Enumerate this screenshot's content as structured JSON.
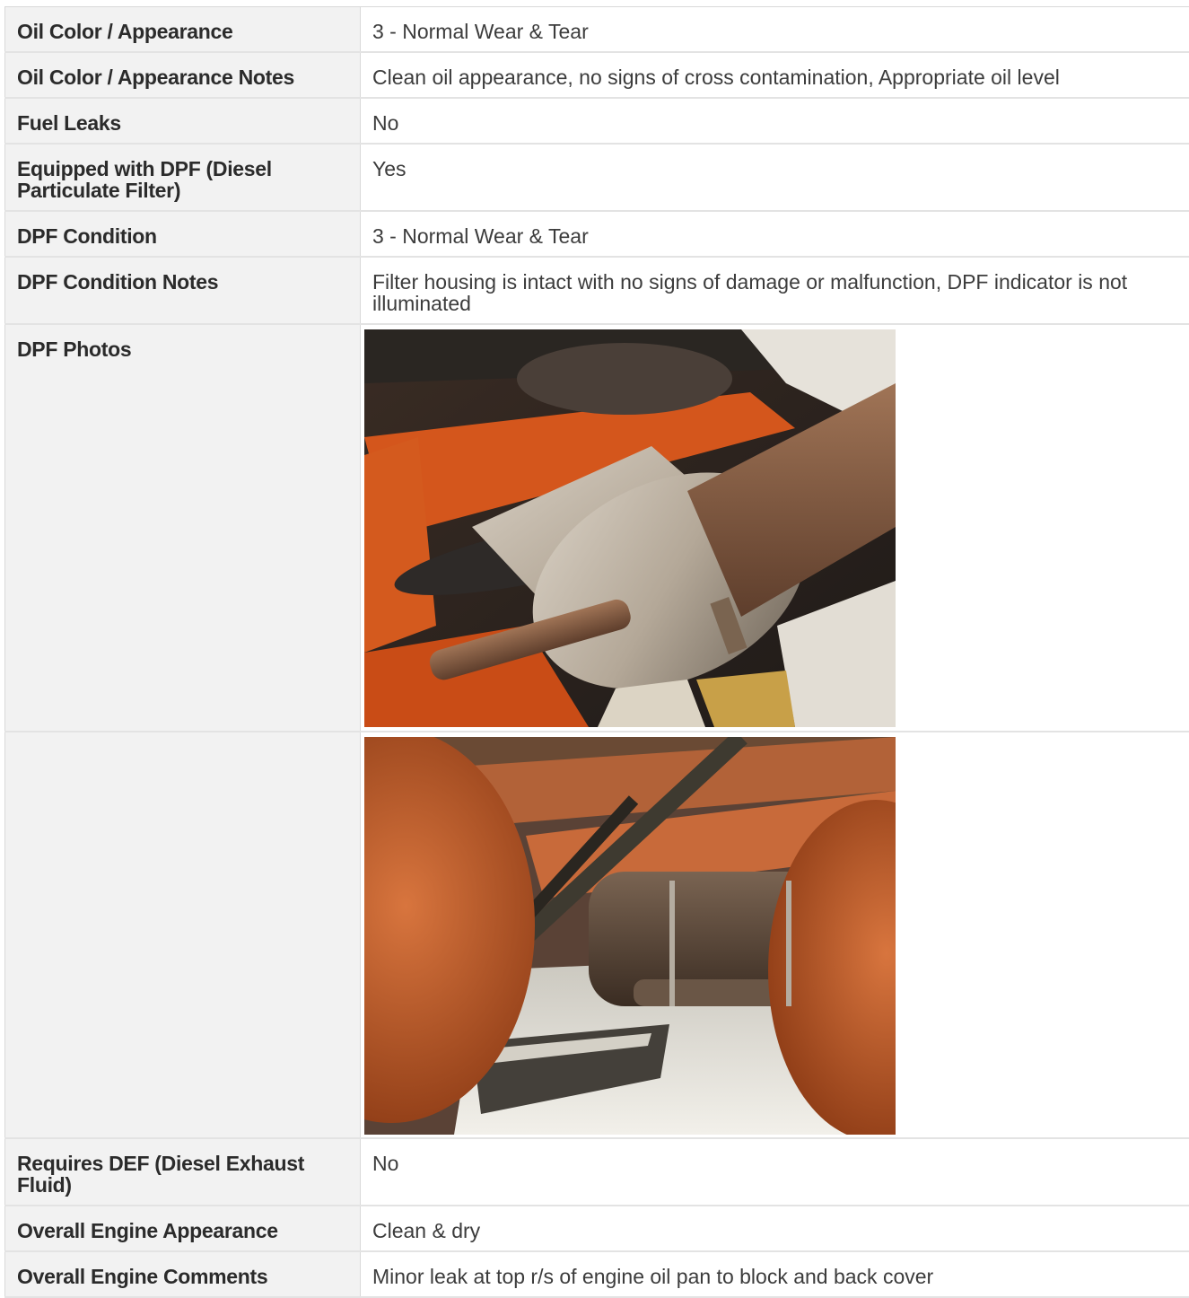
{
  "rows": [
    {
      "label": "Oil Color / Appearance",
      "value": "3 - Normal Wear & Tear"
    },
    {
      "label": "Oil Color / Appearance Notes",
      "value": "Clean oil appearance, no signs of cross contamination, Appropriate oil level"
    },
    {
      "label": "Fuel Leaks",
      "value": "No"
    },
    {
      "label": "Equipped with DPF (Diesel Particulate Filter)",
      "value": "Yes"
    },
    {
      "label": "DPF Condition",
      "value": "3 - Normal Wear & Tear"
    },
    {
      "label": "DPF Condition Notes",
      "value": "Filter housing is intact with no signs of damage or malfunction, DPF indicator is not illuminated"
    },
    {
      "label": "DPF Photos",
      "value": ""
    },
    {
      "label": "",
      "value": ""
    },
    {
      "label": "Requires DEF (Diesel Exhaust Fluid)",
      "value": "No"
    },
    {
      "label": "Overall Engine Appearance",
      "value": "Clean & dry"
    },
    {
      "label": "Overall Engine Comments",
      "value": "Minor leak at top r/s of engine oil pan to block and back cover"
    }
  ]
}
